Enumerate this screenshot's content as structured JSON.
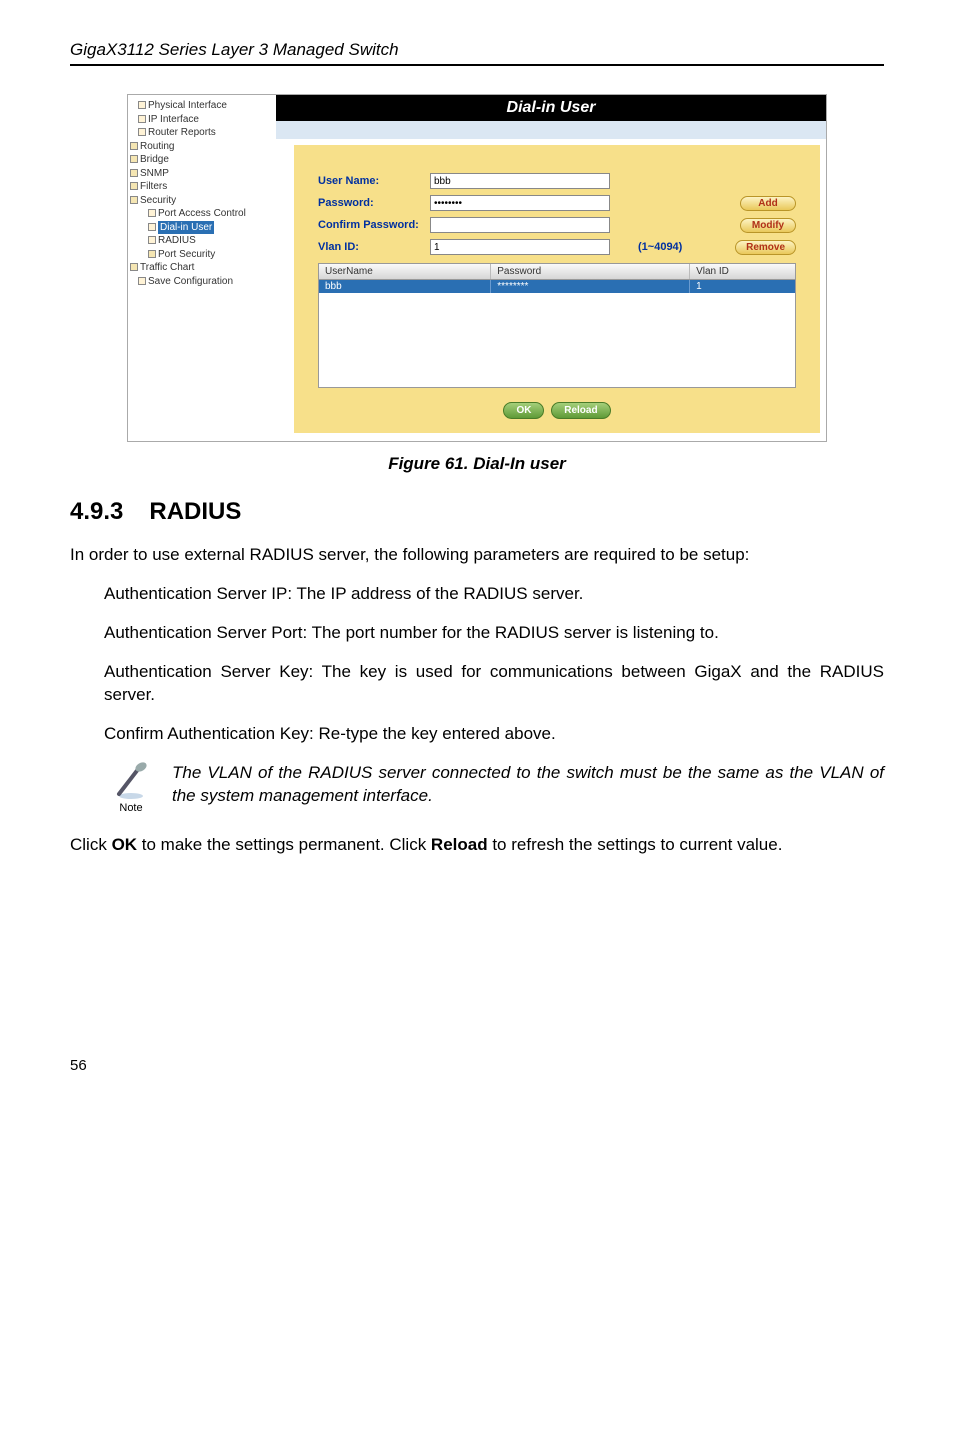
{
  "header": {
    "title": "GigaX3112 Series Layer 3 Managed Switch"
  },
  "screenshot": {
    "banner": "Dial-in User",
    "tree": {
      "items": [
        {
          "label": "Physical Interface",
          "cls": "ind1"
        },
        {
          "label": "IP Interface",
          "cls": "ind1"
        },
        {
          "label": "Router Reports",
          "cls": "ind1"
        },
        {
          "label": "Routing",
          "cls": "",
          "folder": true
        },
        {
          "label": "Bridge",
          "cls": "",
          "folder": true
        },
        {
          "label": "SNMP",
          "cls": "",
          "folder": true
        },
        {
          "label": "Filters",
          "cls": "",
          "folder": true
        },
        {
          "label": "Security",
          "cls": "",
          "folder": true
        },
        {
          "label": "Port Access Control",
          "cls": "ind2"
        },
        {
          "label": "Dial-in User",
          "cls": "ind2",
          "selected": true
        },
        {
          "label": "RADIUS",
          "cls": "ind2"
        },
        {
          "label": "Port Security",
          "cls": "ind2",
          "folder": true
        },
        {
          "label": "Traffic Chart",
          "cls": "",
          "folder": true
        },
        {
          "label": "Save Configuration",
          "cls": "ind1"
        }
      ]
    },
    "form": {
      "username_label": "User Name:",
      "username_value": "bbb",
      "password_label": "Password:",
      "password_value": "••••••••",
      "confirm_label": "Confirm Password:",
      "confirm_value": "",
      "vlan_label": "Vlan ID:",
      "vlan_value": "1",
      "vlan_range": "(1~4094)",
      "btn_add": "Add",
      "btn_modify": "Modify",
      "btn_remove": "Remove"
    },
    "table": {
      "headers": {
        "username": "UserName",
        "password": "Password",
        "vlanid": "Vlan ID"
      },
      "rows": [
        {
          "username": "bbb",
          "password": "********",
          "vlanid": "1"
        }
      ]
    },
    "buttons": {
      "ok": "OK",
      "reload": "Reload"
    }
  },
  "caption": "Figure 61. Dial-In user",
  "section": {
    "number": "4.9.3",
    "title": "RADIUS"
  },
  "paragraphs": {
    "intro": "In order to use external RADIUS server, the following parameters are required to be setup:",
    "p1": "Authentication Server IP: The IP address of the RADIUS server.",
    "p2": "Authentication Server Port: The port number for the RADIUS server is listening to.",
    "p3": "Authentication Server Key: The key is used for communications between GigaX and the RADIUS server.",
    "p4": "Confirm Authentication Key: Re-type the key entered above.",
    "note": "The VLAN of the RADIUS server connected to the switch must be the same as the VLAN of the system management interface.",
    "note_label": "Note",
    "outro_1": "Click ",
    "outro_ok": "OK",
    "outro_2": " to make the settings permanent. Click ",
    "outro_reload": "Reload",
    "outro_3": " to refresh the settings to current value."
  },
  "page_number": "56"
}
